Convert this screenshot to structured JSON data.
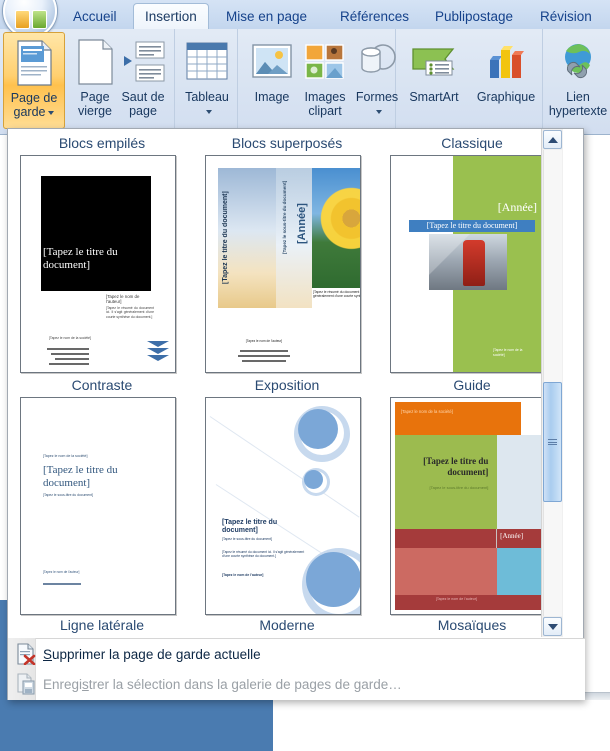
{
  "app": {
    "orb_icon": "office-orb-icon"
  },
  "tabs": [
    {
      "label": "Accueil",
      "active": false
    },
    {
      "label": "Insertion",
      "active": true
    },
    {
      "label": "Mise en page",
      "active": false
    },
    {
      "label": "Références",
      "active": false
    },
    {
      "label": "Publipostage",
      "active": false
    },
    {
      "label": "Révision",
      "active": false
    }
  ],
  "ribbon": {
    "buttons": [
      {
        "id": "page-de-garde",
        "line1": "Page de",
        "line2": "garde",
        "icon": "cover-page-icon",
        "has_caret": true,
        "active": true
      },
      {
        "id": "page-vierge",
        "line1": "Page",
        "line2": "vierge",
        "icon": "blank-page-icon",
        "has_caret": false,
        "active": false
      },
      {
        "id": "saut-de-page",
        "line1": "Saut de",
        "line2": "page",
        "icon": "page-break-icon",
        "has_caret": false,
        "active": false
      },
      {
        "id": "tableau",
        "line1": "Tableau",
        "line2": "",
        "icon": "table-icon",
        "has_caret": true,
        "active": false
      },
      {
        "id": "image",
        "line1": "Image",
        "line2": "",
        "icon": "picture-icon",
        "has_caret": false,
        "active": false
      },
      {
        "id": "images-clipart",
        "line1": "Images",
        "line2": "clipart",
        "icon": "clipart-icon",
        "has_caret": false,
        "active": false
      },
      {
        "id": "formes",
        "line1": "Formes",
        "line2": "",
        "icon": "shapes-icon",
        "has_caret": true,
        "active": false
      },
      {
        "id": "smartart",
        "line1": "SmartArt",
        "line2": "",
        "icon": "smartart-icon",
        "has_caret": false,
        "active": false
      },
      {
        "id": "graphique",
        "line1": "Graphique",
        "line2": "",
        "icon": "chart-icon",
        "has_caret": false,
        "active": false
      },
      {
        "id": "lien-hypertexte",
        "line1": "Lien",
        "line2": "hypertexte",
        "icon": "hyperlink-icon",
        "has_caret": false,
        "active": false
      }
    ]
  },
  "gallery": {
    "headings": [
      "Blocs empilés",
      "Blocs superposés",
      "Classique",
      "Contraste",
      "Exposition",
      "Guide",
      "Ligne latérale",
      "Moderne",
      "Mosaïques"
    ],
    "row1": [
      {
        "name": "Contraste",
        "heading_above": "Blocs empilés"
      },
      {
        "name": "Exposition",
        "heading_above": "Blocs superposés"
      },
      {
        "name": "Guide",
        "heading_above": "Classique"
      }
    ],
    "row2": [
      {
        "name": "Ligne latérale",
        "heading_above": "Contraste"
      },
      {
        "name": "Moderne",
        "heading_above": "Exposition"
      },
      {
        "name": "Mosaïques",
        "heading_above": "Guide"
      }
    ],
    "placeholders": {
      "title": "[Tapez le titre du document]",
      "subtitle": "[Tapez le sous-titre du document]",
      "author": "[Tapez le nom de l'auteur]",
      "year": "[Année]",
      "company": "[Tapez le nom de la société]",
      "abstract": "[Tapez le résumé du document ici. Il s'agit généralement d'une courte synthèse du document.]"
    },
    "scrollbar": {
      "up_icon": "scroll-up-arrow-icon",
      "down_icon": "scroll-down-arrow-icon",
      "thumb_grip_icon": "scroll-thumb-grip-icon"
    }
  },
  "menu": {
    "items": [
      {
        "label_pre": "",
        "accel": "S",
        "label_post": "upprimer la page de garde actuelle",
        "icon": "delete-cover-page-icon",
        "disabled": false
      },
      {
        "label_pre": "Enregi",
        "accel": "s",
        "label_post": "trer la sélection dans la galerie de pages de garde…",
        "icon": "save-selection-icon",
        "disabled": true
      }
    ]
  },
  "colors": {
    "accent_orange": "#ffc14d",
    "tab_text": "#15428b",
    "ribbon_bg": "#dce6f3",
    "panel_border": "#a2a9b2",
    "doc_blue": "#4a7bb0"
  }
}
